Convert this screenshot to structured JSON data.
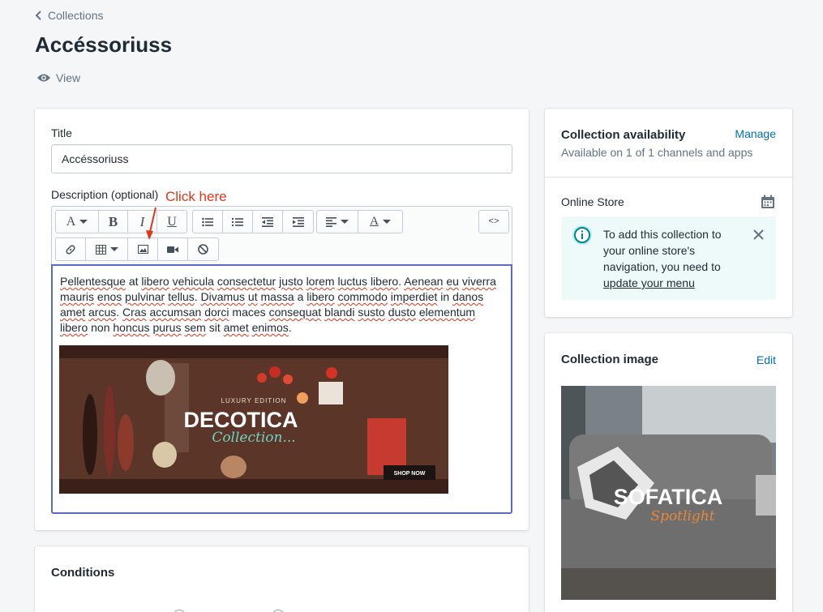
{
  "breadcrumb": {
    "label": "Collections"
  },
  "page": {
    "title": "Accéssoriuss",
    "view_label": "View"
  },
  "form": {
    "title_label": "Title",
    "title_value": "Accéssoriuss",
    "description_label": "Description (optional)",
    "annotation": "Click here",
    "description_parts": [
      {
        "t": "Pellentesque",
        "s": true
      },
      {
        "t": " at ",
        "s": false
      },
      {
        "t": "libero",
        "s": true
      },
      {
        "t": " ",
        "s": false
      },
      {
        "t": "vehicula",
        "s": true
      },
      {
        "t": " ",
        "s": false
      },
      {
        "t": "consectetur",
        "s": true
      },
      {
        "t": " ",
        "s": false
      },
      {
        "t": "justo",
        "s": true
      },
      {
        "t": " ",
        "s": false
      },
      {
        "t": "lorem",
        "s": true
      },
      {
        "t": " ",
        "s": false
      },
      {
        "t": "luctus",
        "s": true
      },
      {
        "t": " ",
        "s": false
      },
      {
        "t": "libero",
        "s": true
      },
      {
        "t": ". ",
        "s": false
      },
      {
        "t": "Aenean",
        "s": true
      },
      {
        "t": " ",
        "s": false
      },
      {
        "t": "eu",
        "s": true
      },
      {
        "t": " ",
        "s": false
      },
      {
        "t": "viverra",
        "s": true
      },
      {
        "t": " ",
        "s": false
      },
      {
        "t": "mauris",
        "s": true
      },
      {
        "t": " ",
        "s": false
      },
      {
        "t": "enos",
        "s": true
      },
      {
        "t": " ",
        "s": false
      },
      {
        "t": "pulvinar",
        "s": true
      },
      {
        "t": " ",
        "s": false
      },
      {
        "t": "tellus",
        "s": true
      },
      {
        "t": ". ",
        "s": false
      },
      {
        "t": "Divamus",
        "s": true
      },
      {
        "t": " ",
        "s": false
      },
      {
        "t": "ut",
        "s": true
      },
      {
        "t": " ",
        "s": false
      },
      {
        "t": "massa",
        "s": true
      },
      {
        "t": " a ",
        "s": false
      },
      {
        "t": "libero",
        "s": true
      },
      {
        "t": " ",
        "s": false
      },
      {
        "t": "commodo",
        "s": true
      },
      {
        "t": " ",
        "s": false
      },
      {
        "t": "imperdiet",
        "s": true
      },
      {
        "t": " in ",
        "s": false
      },
      {
        "t": "danos",
        "s": true
      },
      {
        "t": " ",
        "s": false
      },
      {
        "t": "amet",
        "s": true
      },
      {
        "t": " ",
        "s": false
      },
      {
        "t": "arcus",
        "s": true
      },
      {
        "t": ". ",
        "s": false
      },
      {
        "t": "Cras",
        "s": true
      },
      {
        "t": " ",
        "s": false
      },
      {
        "t": "accumsan",
        "s": true
      },
      {
        "t": " ",
        "s": false
      },
      {
        "t": "dorci",
        "s": true
      },
      {
        "t": " maces ",
        "s": false
      },
      {
        "t": "consequat",
        "s": true
      },
      {
        "t": " ",
        "s": false
      },
      {
        "t": "blandi",
        "s": true
      },
      {
        "t": " ",
        "s": false
      },
      {
        "t": "susto",
        "s": true
      },
      {
        "t": " ",
        "s": false
      },
      {
        "t": "dusto",
        "s": true
      },
      {
        "t": " ",
        "s": false
      },
      {
        "t": "elementum",
        "s": true
      },
      {
        "t": " ",
        "s": false
      },
      {
        "t": "libero",
        "s": true
      },
      {
        "t": " ",
        "s": false
      },
      {
        "t": "non",
        "s": false
      },
      {
        "t": " ",
        "s": false
      },
      {
        "t": "honcus",
        "s": true
      },
      {
        "t": " ",
        "s": false
      },
      {
        "t": "purus",
        "s": true
      },
      {
        "t": " ",
        "s": false
      },
      {
        "t": "sem",
        "s": true
      },
      {
        "t": " sit ",
        "s": false
      },
      {
        "t": "amet",
        "s": true
      },
      {
        "t": " ",
        "s": false
      },
      {
        "t": "enimos",
        "s": true
      },
      {
        "t": ".",
        "s": false
      }
    ],
    "banner": {
      "edition": "LUXURY EDITION",
      "brand": "DECOTICA",
      "script": "Collection...",
      "cta": "SHOP NOW"
    }
  },
  "toolbar": {
    "font_glyph": "A",
    "bold": "B",
    "italic": "I",
    "underline": "U",
    "code": "<>",
    "color_glyph": "A"
  },
  "conditions": {
    "title": "Conditions"
  },
  "availability": {
    "title": "Collection availability",
    "manage_label": "Manage",
    "subtitle": "Available on 1 of 1 channels and apps",
    "channel": "Online Store",
    "notice_prefix": "To add this collection to your online store's navigation, you need to ",
    "notice_link": "update your menu"
  },
  "collection_image": {
    "title": "Collection image",
    "edit_label": "Edit",
    "brand": "SOFATICA",
    "script": "Spotlight"
  },
  "colors": {
    "accent": "#5c6ac4",
    "link": "#006fbb",
    "annotation": "#de3618",
    "info_bg": "#eef9f9",
    "info_icon": "#47c1bf"
  }
}
